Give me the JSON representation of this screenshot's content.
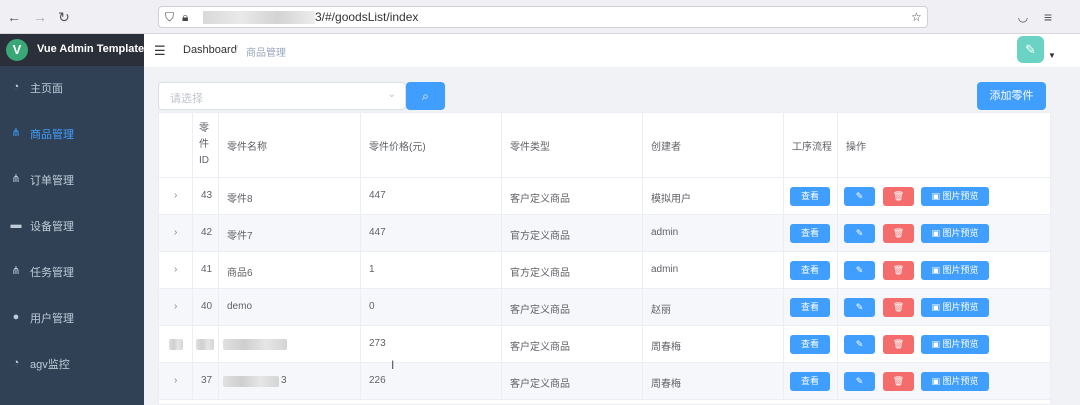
{
  "browser": {
    "url_suffix": "3/#/goodsList/index"
  },
  "sidebar": {
    "title": "Vue Admin Template",
    "logo_letter": "V",
    "items": [
      {
        "label": "主页面"
      },
      {
        "label": "商品管理"
      },
      {
        "label": "订单管理"
      },
      {
        "label": "设备管理"
      },
      {
        "label": "任务管理"
      },
      {
        "label": "用户管理"
      },
      {
        "label": "agv监控"
      }
    ]
  },
  "header": {
    "breadcrumb_home": "Dashboard",
    "breadcrumb_sep": "/",
    "breadcrumb_current": "商品管理"
  },
  "toolbar": {
    "select_placeholder": "请选择",
    "add_label": "添加零件"
  },
  "table": {
    "columns": [
      "零件ID",
      "零件名称",
      "零件价格(元)",
      "零件类型",
      "创建者",
      "工序流程",
      "操作"
    ],
    "rows": [
      {
        "id": "43",
        "name": "零件8",
        "price": "447",
        "type": "客户定义商品",
        "creator": "模拟用户"
      },
      {
        "id": "42",
        "name": "零件7",
        "price": "447",
        "type": "官方定义商品",
        "creator": "admin"
      },
      {
        "id": "41",
        "name": "商品6",
        "price": "1",
        "type": "官方定义商品",
        "creator": "admin"
      },
      {
        "id": "40",
        "name": "demo",
        "price": "0",
        "type": "客户定义商品",
        "creator": "赵丽"
      },
      {
        "id": "",
        "name": "",
        "price": "273",
        "type": "客户定义商品",
        "creator": "周春梅"
      },
      {
        "id": "37",
        "name": "3",
        "price": "226",
        "type": "客户定义商品",
        "creator": "周春梅"
      }
    ],
    "actions": {
      "view": "查看",
      "image_preview": "图片预览"
    }
  },
  "colors": {
    "sidebar_bg": "#304156",
    "primary": "#409eff",
    "danger": "#f56c6c"
  }
}
